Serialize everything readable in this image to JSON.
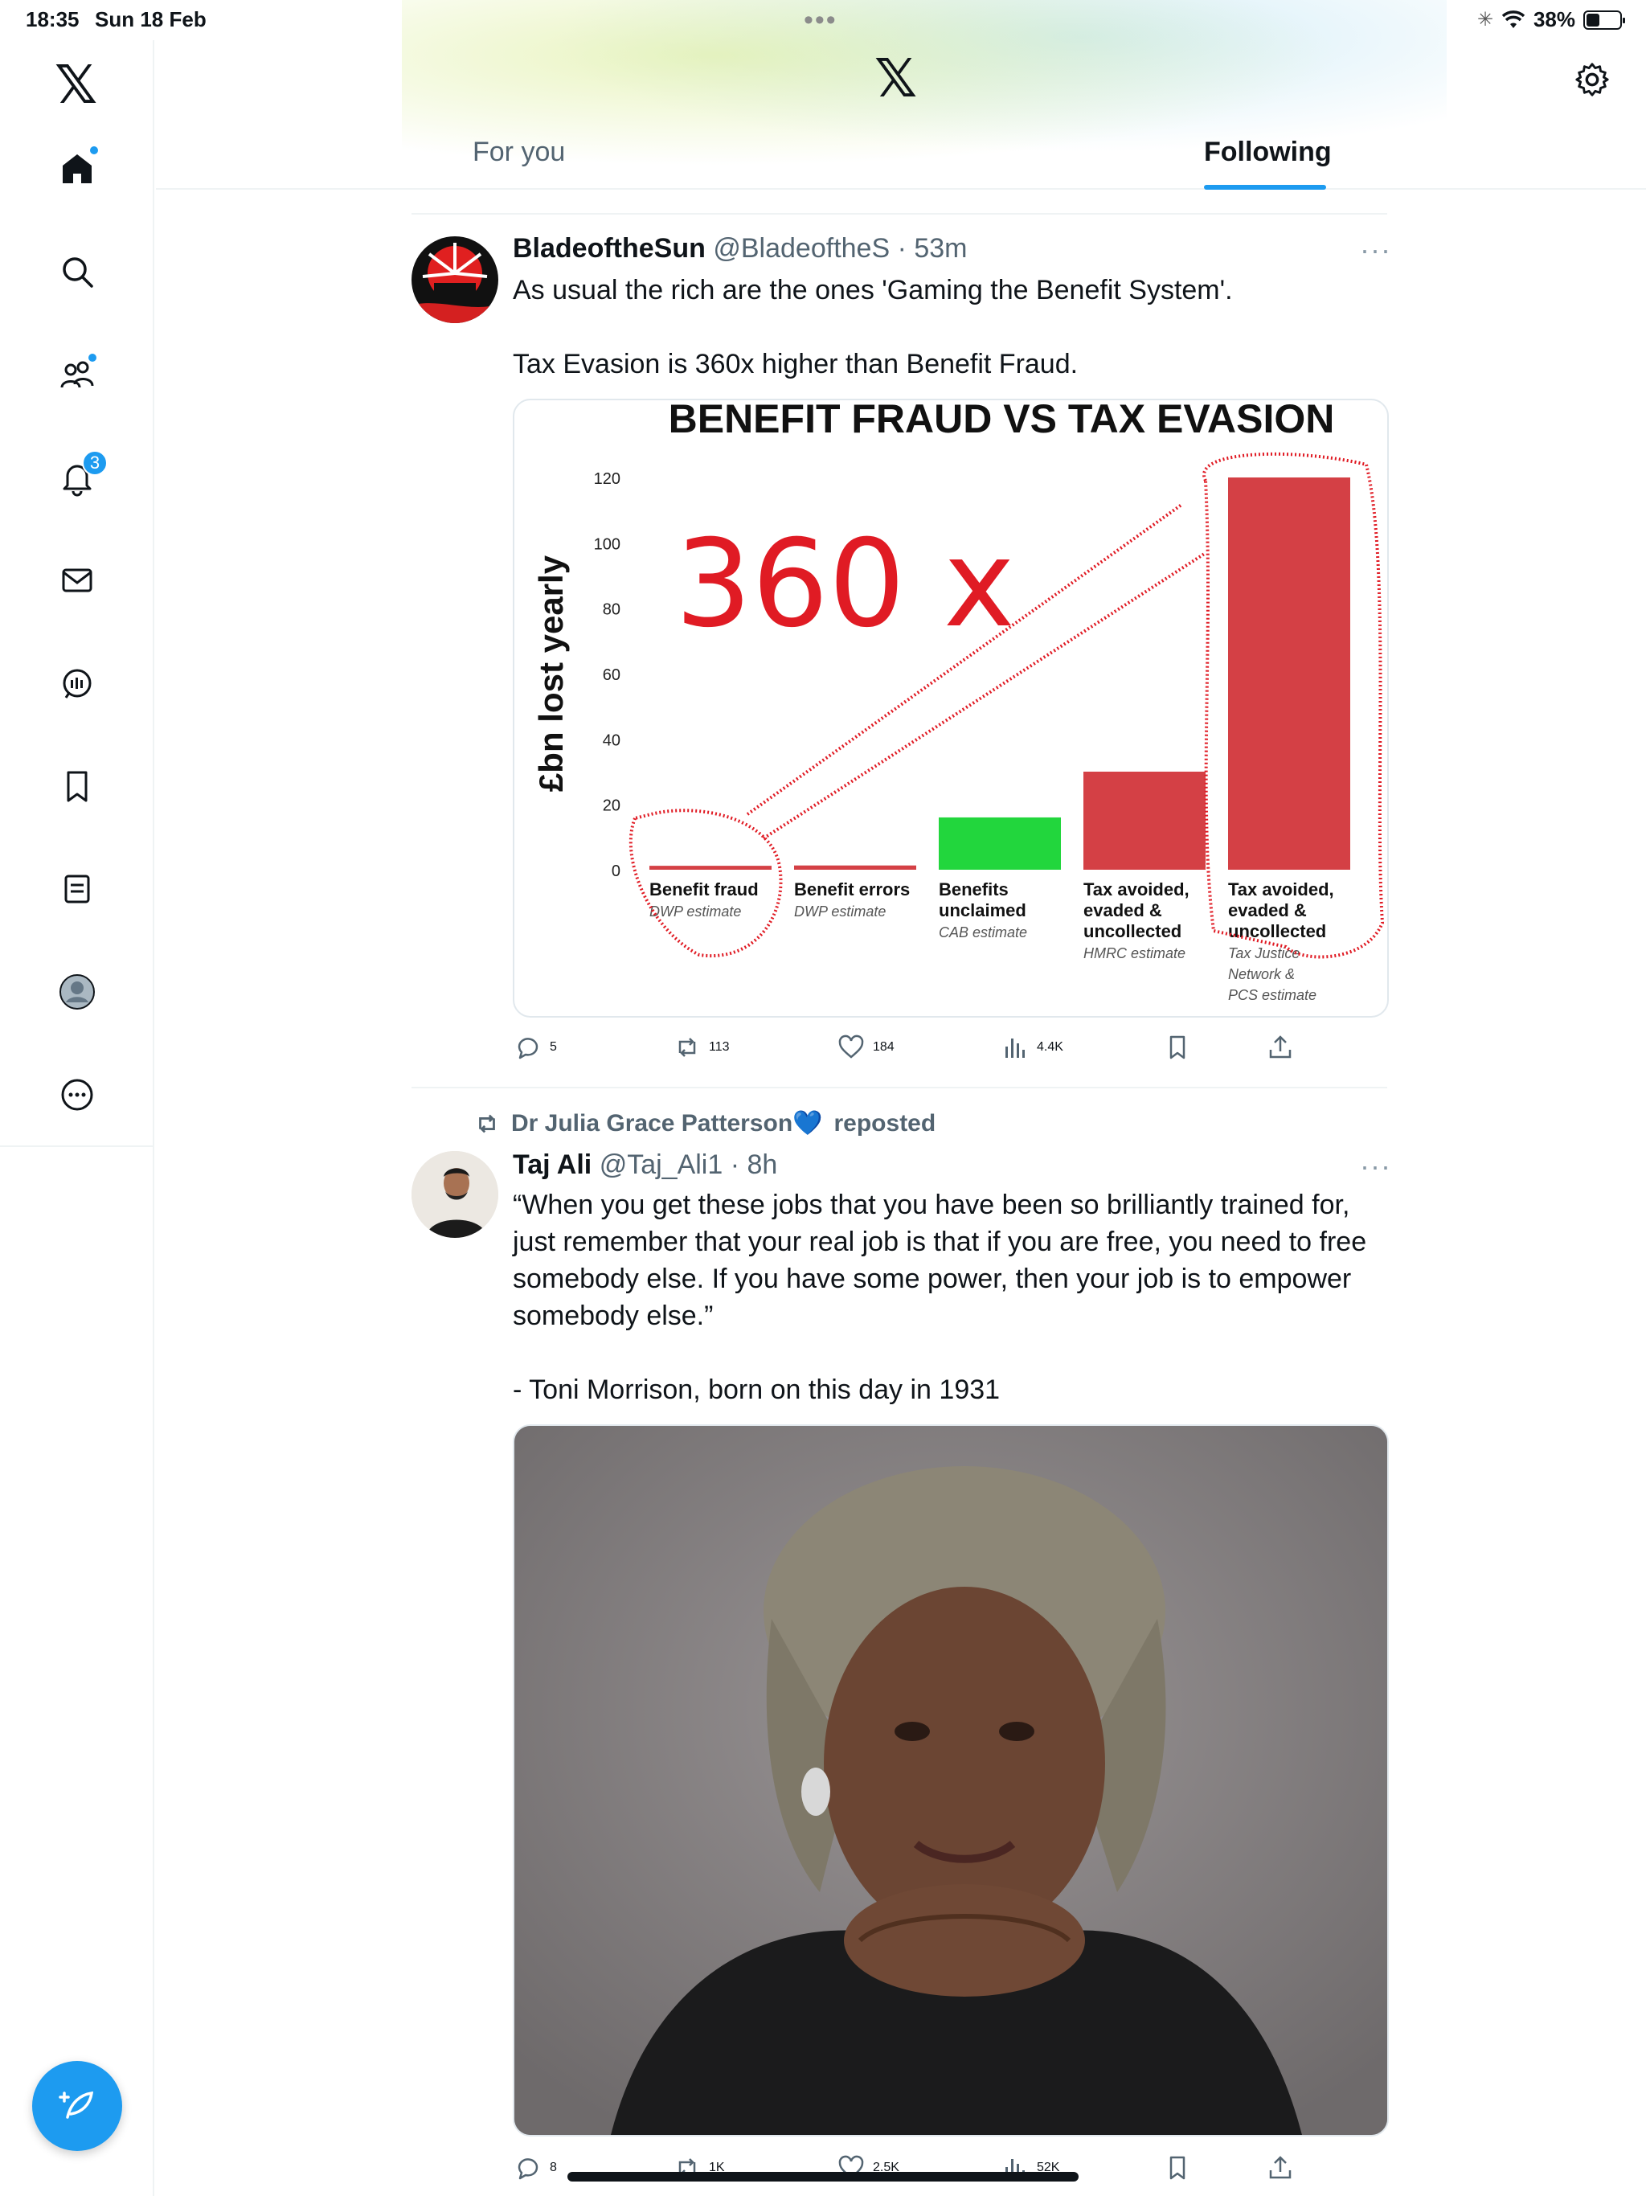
{
  "status_bar": {
    "time": "18:35",
    "date": "Sun 18 Feb",
    "battery": "38%",
    "battery_level": 0.38
  },
  "header": {
    "tabs": [
      {
        "label": "For you"
      },
      {
        "label": "Following"
      }
    ],
    "active_tab": "Following"
  },
  "sidebar": {
    "items": [
      {
        "name": "home-icon"
      },
      {
        "name": "search-icon"
      },
      {
        "name": "communities-icon"
      },
      {
        "name": "notifications-icon",
        "badge": "3"
      },
      {
        "name": "messages-icon"
      },
      {
        "name": "spaces-icon"
      },
      {
        "name": "bookmarks-icon"
      },
      {
        "name": "lists-icon"
      },
      {
        "name": "profile-icon"
      },
      {
        "name": "more-icon"
      }
    ]
  },
  "posts": [
    {
      "name": "BladeoftheSun",
      "handle": "@BladeoftheS",
      "time": "· 53m",
      "text": "As usual the rich are the ones 'Gaming the Benefit System'.\n\nTax Evasion is 360x higher than Benefit Fraud.",
      "replies": "5",
      "reposts": "113",
      "likes": "184",
      "views": "4.4K"
    },
    {
      "reposted_by": "Dr Julia Grace Patterson💙",
      "reposted_label": "reposted",
      "name": "Taj Ali",
      "handle": "@Taj_Ali1",
      "time": "· 8h",
      "text": "“When you get these jobs that you have been so brilliantly trained for, just remember that your real job is that if you are free, you need to free somebody else. If you have some power, then your job is to empower somebody else.”\n\n- Toni Morrison, born on this day in 1931",
      "replies": "8",
      "reposts": "1K",
      "likes": "2.5K",
      "views": "52K"
    }
  ],
  "chart_data": {
    "type": "bar",
    "title": "BENEFIT FRAUD VS TAX EVASION",
    "ylabel": "£bn lost yearly",
    "ylim": [
      0,
      120
    ],
    "yticks": [
      "0",
      "20",
      "40",
      "60",
      "80",
      "100",
      "120"
    ],
    "categories": [
      {
        "label": "Benefit fraud",
        "source": "DWP estimate"
      },
      {
        "label": "Benefit errors",
        "source": "DWP estimate"
      },
      {
        "label": "Benefits unclaimed",
        "source": "CAB estimate"
      },
      {
        "label": "Tax avoided, evaded & uncollected",
        "source": "HMRC estimate"
      },
      {
        "label": "Tax avoided, evaded & uncollected",
        "source": "Tax Justice Network & PCS estimate"
      }
    ],
    "values": [
      1.2,
      1.3,
      16,
      30,
      120
    ],
    "colors": [
      "#d44045",
      "#d44045",
      "#22d63d",
      "#d44045",
      "#d44045"
    ],
    "annotation": "360 x"
  }
}
